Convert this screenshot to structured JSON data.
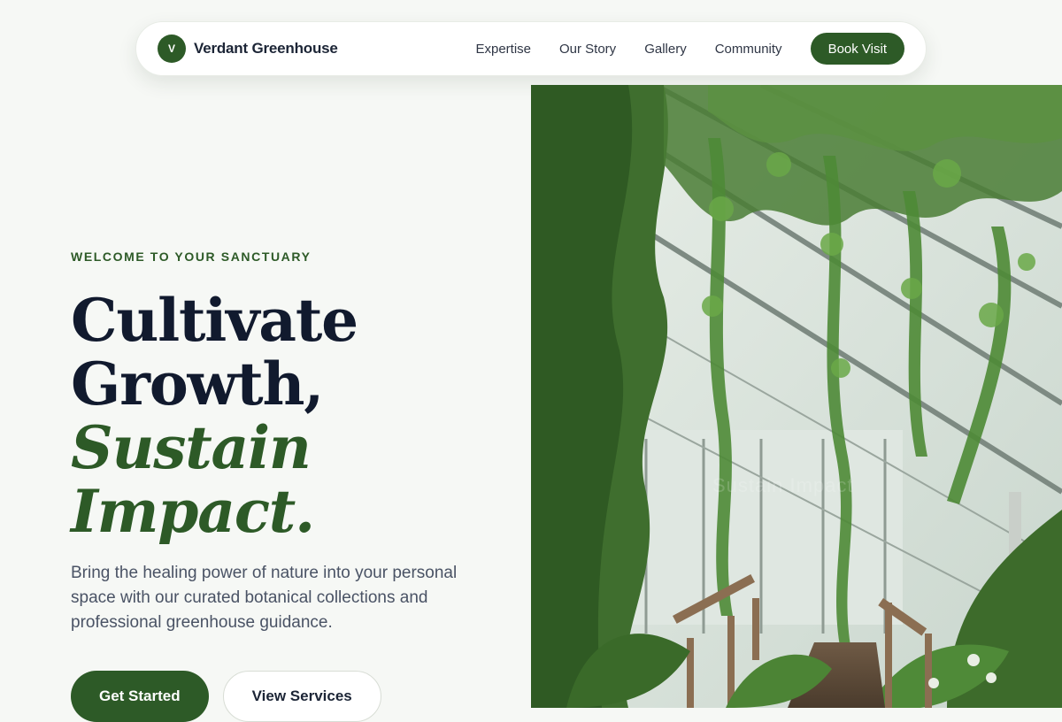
{
  "nav": {
    "brand_initial": "V",
    "brand_name": "Verdant Greenhouse",
    "links": [
      "Expertise",
      "Our Story",
      "Gallery",
      "Community"
    ],
    "cta": "Book Visit"
  },
  "hero": {
    "eyebrow": "WELCOME TO YOUR SANCTUARY",
    "headline": {
      "line1": "Cultivate",
      "line2": "Growth,",
      "line3": "Sustain",
      "line4": "Impact."
    },
    "lede": "Bring the healing power of nature into your personal space with our curated botanical collections and professional greenhouse guidance.",
    "primary_button": "Get Started",
    "secondary_button": "View Services",
    "image_watermark": "Sustain Impact"
  },
  "colors": {
    "brand_green": "#2d5a27",
    "ink": "#111a2e",
    "background": "#f6f8f5"
  }
}
